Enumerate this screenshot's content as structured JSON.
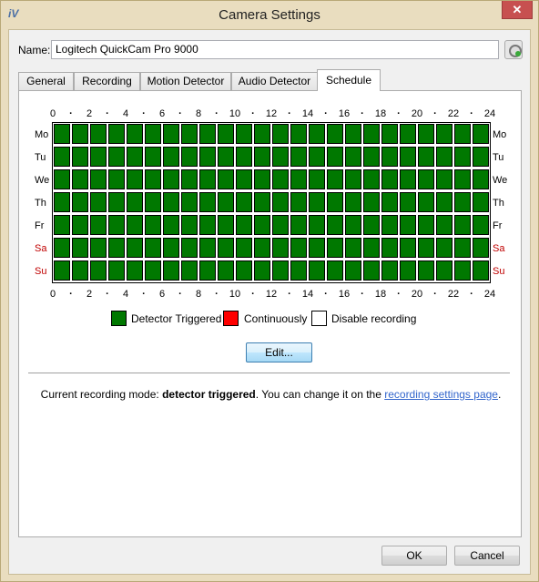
{
  "window": {
    "title": "Camera Settings",
    "app_icon_text": "iV",
    "close_label": "✕"
  },
  "name_field": {
    "label": "Name:",
    "value": "Logitech QuickCam Pro 9000"
  },
  "tabs": [
    {
      "label": "General"
    },
    {
      "label": "Recording"
    },
    {
      "label": "Motion Detector"
    },
    {
      "label": "Audio Detector"
    },
    {
      "label": "Schedule"
    }
  ],
  "active_tab": "Schedule",
  "schedule": {
    "hour_labels": [
      "0",
      "2",
      "4",
      "6",
      "8",
      "10",
      "12",
      "14",
      "16",
      "18",
      "20",
      "22",
      "24"
    ],
    "days": [
      {
        "label": "Mo",
        "weekend": false
      },
      {
        "label": "Tu",
        "weekend": false
      },
      {
        "label": "We",
        "weekend": false
      },
      {
        "label": "Th",
        "weekend": false
      },
      {
        "label": "Fr",
        "weekend": false
      },
      {
        "label": "Sa",
        "weekend": true
      },
      {
        "label": "Su",
        "weekend": true
      }
    ],
    "cell_mode": "Detector Triggered",
    "legend": [
      {
        "label": "Detector Triggered",
        "color": "#007800"
      },
      {
        "label": "Continuously",
        "color": "#ff0000"
      },
      {
        "label": "Disable recording",
        "color": "#ffffff"
      }
    ],
    "edit_button": "Edit...",
    "mode_text": {
      "prefix": "Current recording mode: ",
      "mode": "detector triggered",
      "middle": ". You can change it on the ",
      "link": "recording settings page",
      "suffix": "."
    }
  },
  "buttons": {
    "ok": "OK",
    "cancel": "Cancel"
  },
  "colors": {
    "detector": "#007800",
    "weekend_label": "#c00000",
    "link": "#3366cc"
  }
}
